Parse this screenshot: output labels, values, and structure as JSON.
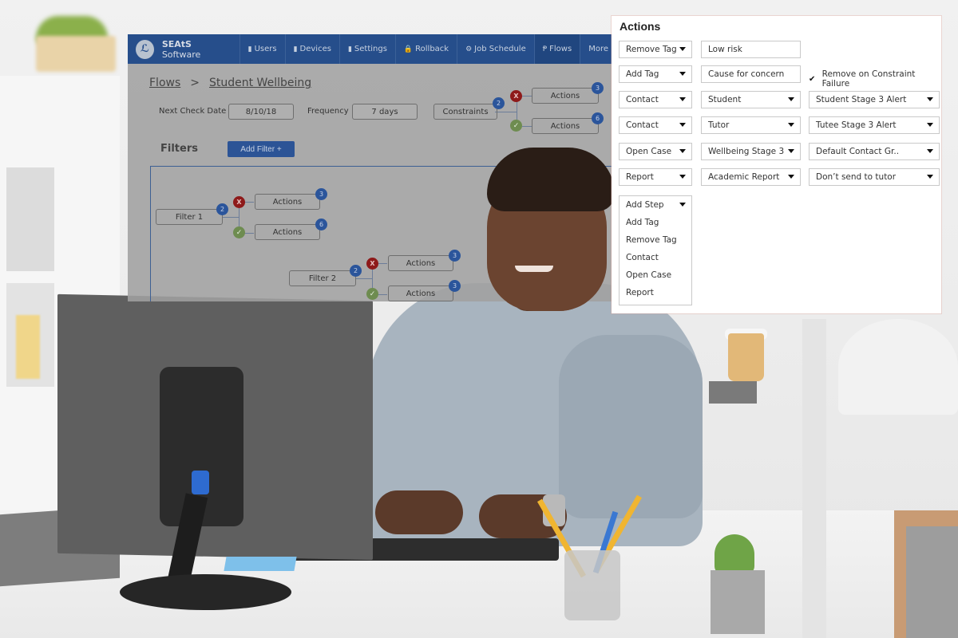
{
  "app": {
    "brand": {
      "bold": "SEAtS",
      "light": "Software",
      "logo_icon": "leaf-logo-icon"
    },
    "nav": [
      {
        "label": "Users",
        "icon": "device-icon",
        "glyph": "▮"
      },
      {
        "label": "Devices",
        "icon": "device-icon",
        "glyph": "▮"
      },
      {
        "label": "Settings",
        "icon": "device-icon",
        "glyph": "▮"
      },
      {
        "label": "Rollback",
        "icon": "lock-icon",
        "glyph": "🔒"
      },
      {
        "label": "Job Schedule",
        "icon": "gears-icon",
        "glyph": "⚙"
      },
      {
        "label": "Flows",
        "icon": "branch-icon",
        "glyph": "Ᵽ",
        "active": true
      },
      {
        "label": "More"
      }
    ],
    "breadcrumb": {
      "root": "Flows",
      "separator": ">",
      "current": "Student Wellbeing"
    },
    "next_check_date": {
      "label": "Next Check Date",
      "value": "8/10/18"
    },
    "frequency": {
      "label": "Frequency",
      "value": "7 days"
    },
    "constraints": {
      "label": "Constraints",
      "count": "2",
      "fail": {
        "label": "Actions",
        "count": "3",
        "mark": "X"
      },
      "pass": {
        "label": "Actions",
        "count": "6",
        "mark": "✓"
      }
    },
    "filters_title": "Filters",
    "add_filter_label": "Add Filter +",
    "filters": [
      {
        "label": "Filter 1",
        "count": "2",
        "fail": {
          "label": "Actions",
          "count": "3",
          "mark": "X"
        },
        "pass": {
          "label": "Actions",
          "count": "6",
          "mark": "✓"
        }
      },
      {
        "label": "Filter 2",
        "count": "2",
        "fail": {
          "label": "Actions",
          "count": "3",
          "mark": "X"
        },
        "pass": {
          "label": "Actions",
          "count": "3",
          "mark": "✓"
        }
      }
    ]
  },
  "actions_panel": {
    "title": "Actions",
    "rows": [
      {
        "type": "Remove Tag",
        "value": "Low risk"
      },
      {
        "type": "Add Tag",
        "value": "Cause for concern",
        "checkbox": {
          "label": "Remove on Constraint Failure",
          "checked": true,
          "mark": "✔"
        }
      },
      {
        "type": "Contact",
        "target": "Student",
        "template": "Student Stage 3 Alert"
      },
      {
        "type": "Contact",
        "target": "Tutor",
        "template": "Tutee Stage 3 Alert"
      },
      {
        "type": "Open Case",
        "target": "Wellbeing Stage 3",
        "template": "Default Contact Gr.."
      },
      {
        "type": "Report",
        "target": "Academic Report",
        "template": "Don’t send to tutor"
      }
    ],
    "add_step": {
      "label": "Add Step",
      "options": [
        "Add Tag",
        "Remove Tag",
        "Contact",
        "Open Case",
        "Report"
      ]
    }
  },
  "colors": {
    "nav_bg": "#264e8b",
    "badge_blue": "#2b559b",
    "fail_red": "#8e1a1a",
    "pass_green": "#6e8c50"
  }
}
